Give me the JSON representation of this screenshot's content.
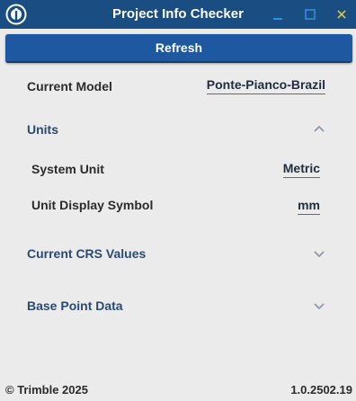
{
  "window": {
    "title": "Project Info Checker",
    "icons": {
      "app": "trimble-logo-icon",
      "minimize": "minimize-icon",
      "maximize": "maximize-icon",
      "close": "close-icon"
    }
  },
  "toolbar": {
    "refresh_label": "Refresh"
  },
  "model": {
    "label": "Current Model",
    "value": "Ponte-Pianco-Brazil"
  },
  "sections": {
    "units": {
      "title": "Units",
      "expanded": true,
      "rows": {
        "system_unit": {
          "label": "System Unit",
          "value": "Metric"
        },
        "display_symbol": {
          "label": "Unit Display Symbol",
          "value": "mm"
        }
      }
    },
    "crs": {
      "title": "Current CRS Values",
      "expanded": false
    },
    "base_point": {
      "title": "Base Point Data",
      "expanded": false
    }
  },
  "footer": {
    "copyright": "© Trimble 2025",
    "version": "1.0.2502.19"
  },
  "colors": {
    "titlebar": "#1a4e83",
    "button": "#1e58a0",
    "window_minmax": "#2f8fe0",
    "close_x": "#d9c64a",
    "section_title": "#2c4a70",
    "background": "#ebebeb"
  }
}
